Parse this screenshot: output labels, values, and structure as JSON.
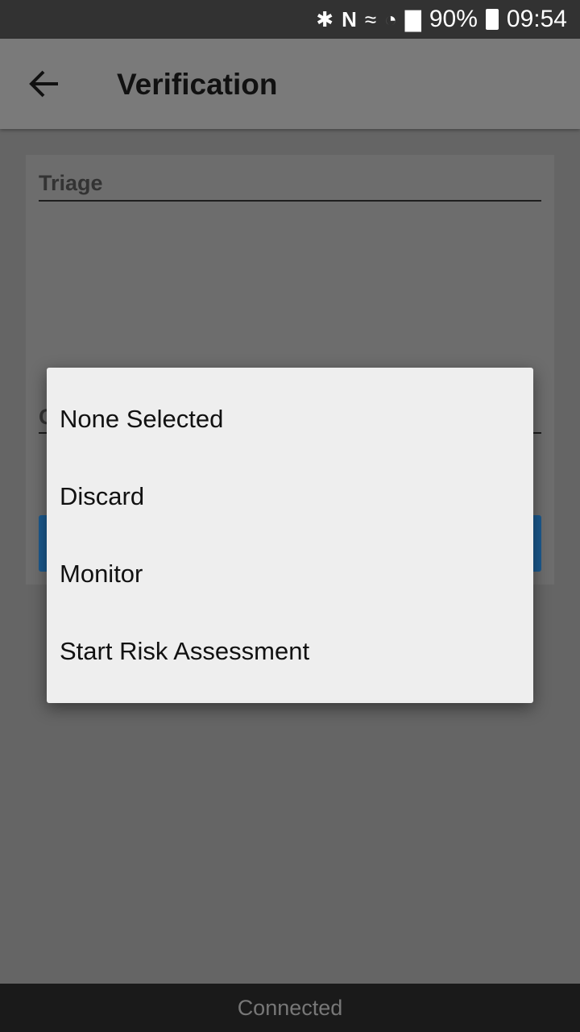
{
  "status_bar": {
    "icons": [
      "bluetooth-icon",
      "nfc-icon",
      "vibrate-icon",
      "wifi-icon",
      "signal-icon"
    ],
    "battery": "90%",
    "time": "09:54"
  },
  "app_bar": {
    "back_icon": "arrow-left-icon",
    "title": "Verification"
  },
  "form": {
    "triage_label": "Triage",
    "second_label_partial": "C",
    "button_color": "#1b5a8f"
  },
  "dialog": {
    "options": [
      {
        "label": "None Selected"
      },
      {
        "label": "Discard"
      },
      {
        "label": "Monitor"
      },
      {
        "label": "Start Risk Assessment"
      }
    ]
  },
  "footer": {
    "connection_status": "Connected"
  }
}
